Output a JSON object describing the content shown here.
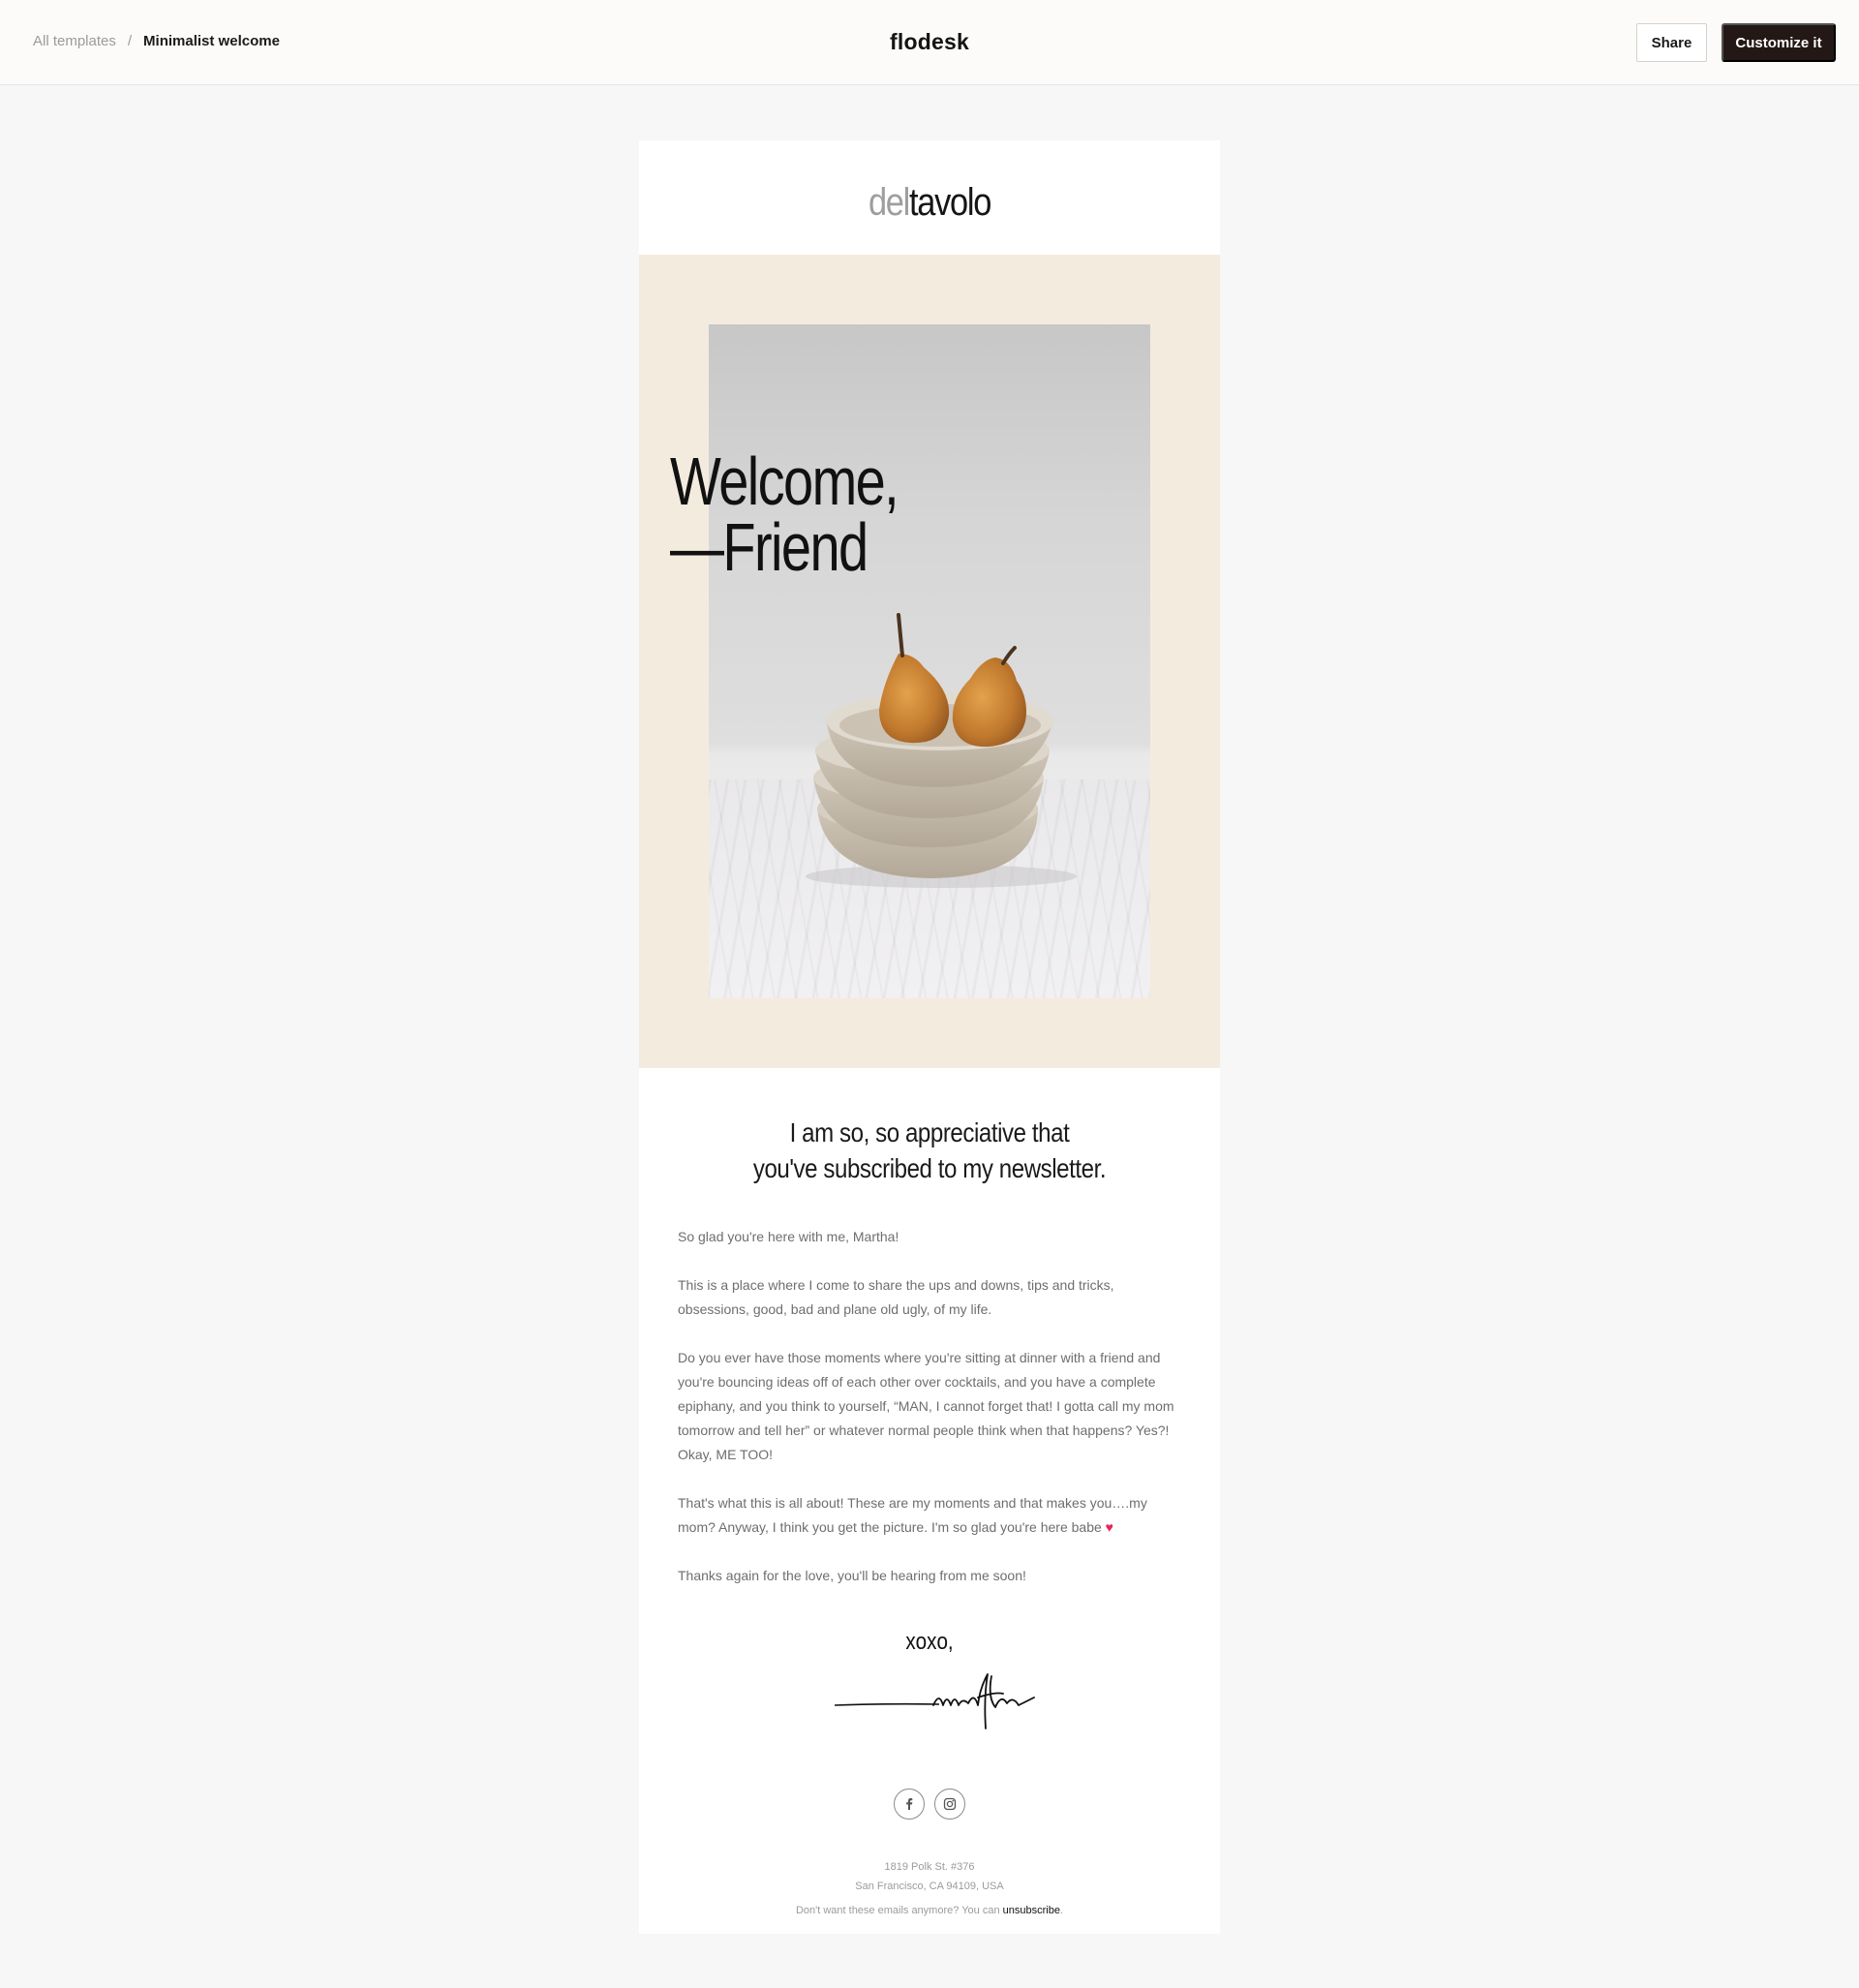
{
  "topbar": {
    "breadcrumb": {
      "parent": "All templates",
      "separator": "/",
      "current": "Minimalist welcome"
    },
    "brand": "flodesk",
    "share_label": "Share",
    "customize_label": "Customize it"
  },
  "email": {
    "logo": {
      "light": "del",
      "dark": "tavolo"
    },
    "hero": {
      "line1": "Welcome,",
      "line2": "—Friend",
      "background_color": "#f4ebdf"
    },
    "intro": {
      "line1": "I am so, so appreciative that",
      "line2": "you've subscribed to my newsletter."
    },
    "paragraphs": {
      "p1": "So glad you're here with me, Martha!",
      "p2": "This is a place where I come to share the ups and downs, tips and tricks, obsessions, good, bad and plane old ugly, of my life.",
      "p3": "Do you ever have those moments where you're sitting at dinner with a friend and you're bouncing ideas off of each other over cocktails, and you have a complete epiphany, and you think to yourself, “MAN, I cannot forget that! I gotta call my mom tomorrow and tell her” or whatever normal people think when that happens? Yes?! Okay, ME TOO!",
      "p4": "That's what this is all about! These are my moments and that makes you….my mom? Anyway, I think you get the picture. I'm so glad you're here babe",
      "p4_emoji": "♥",
      "p5": "Thanks again for the love, you'll be hearing from me soon!"
    },
    "signoff": "xoxo,",
    "signature": "martha",
    "social": {
      "icons": [
        "facebook-icon",
        "instagram-icon"
      ]
    },
    "footer": {
      "address_line1": "1819 Polk St. #376",
      "address_line2": "San Francisco, CA 94109, USA",
      "unsubscribe_text": "Don't want these emails anymore? You can",
      "unsubscribe_link": "unsubscribe",
      "unsubscribe_end": "."
    }
  },
  "colors": {
    "accent_dark": "#231815",
    "heart": "#e8245b",
    "page_bg": "#f7f7f7"
  }
}
